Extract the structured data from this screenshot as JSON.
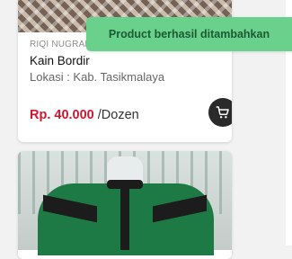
{
  "product_1": {
    "seller": "RIQI NUGRAHA",
    "title": "Kain Bordir",
    "location": "Lokasi : Kab. Tasikmalaya",
    "price": "Rp. 40.000",
    "unit": "/Dozen",
    "cart_icon": "cart-icon"
  },
  "product_2": {
    "image": "shirt-photo"
  },
  "toast": {
    "message": "Product berhasil ditambahkan"
  },
  "colors": {
    "price": "#d0162f",
    "toast_bg": "#6ad18c",
    "toast_text": "#1b5a32",
    "cart_button": "#2a2a2a"
  }
}
